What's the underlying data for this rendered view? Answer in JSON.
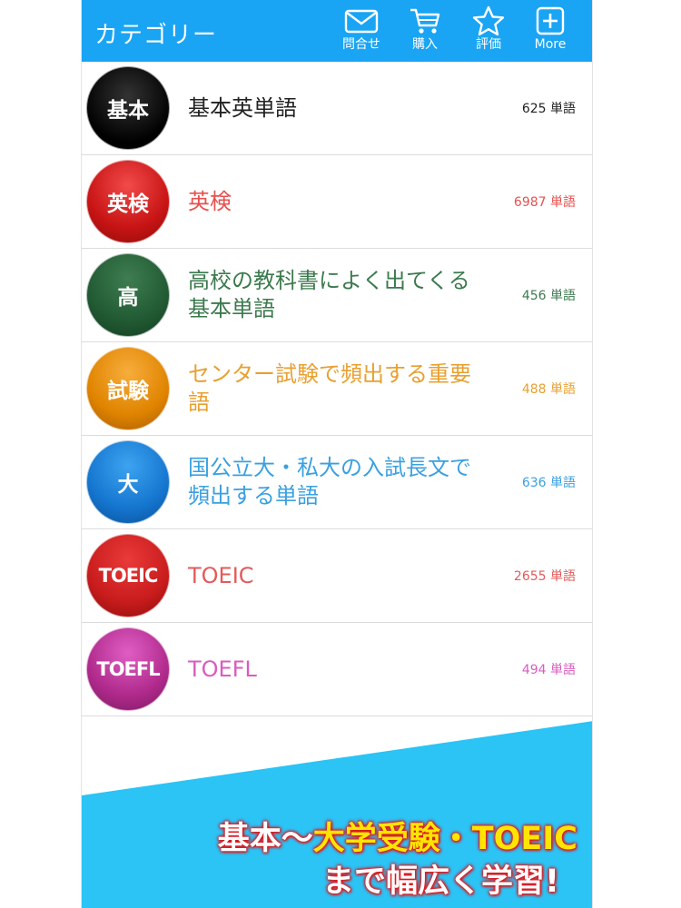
{
  "header": {
    "title": "カテゴリー",
    "buttons": [
      {
        "label": "問合せ",
        "icon": "mail-icon"
      },
      {
        "label": "購入",
        "icon": "cart-icon"
      },
      {
        "label": "評価",
        "icon": "star-icon"
      },
      {
        "label": "More",
        "icon": "plus-box-icon"
      }
    ],
    "color": "#1aa4f4"
  },
  "categories": [
    {
      "badge": "基本",
      "title": "基本英単語",
      "count": "625 単語",
      "color": "#222222",
      "badge_color": "#000000"
    },
    {
      "badge": "英検",
      "title": "英検",
      "count": "6987 単語",
      "color": "#e8504e",
      "badge_color": "#d11b1b"
    },
    {
      "badge": "高",
      "title": "高校の教科書によく出てくる基本単語",
      "count": "456 単語",
      "color": "#3c7a4e",
      "badge_color": "#215a33"
    },
    {
      "badge": "試験",
      "title": "センター試験で頻出する重要語",
      "count": "488 単語",
      "color": "#e8a030",
      "badge_color": "#e08400"
    },
    {
      "badge": "大",
      "title": "国公立大・私大の入試長文で頻出する単語",
      "count": "636 単語",
      "color": "#3aa0e0",
      "badge_color": "#1576cf"
    },
    {
      "badge": "TOEIC",
      "title": "TOEIC",
      "count": "2655 単語",
      "color": "#e45a5a",
      "badge_color": "#c91c1c"
    },
    {
      "badge": "TOEFL",
      "title": "TOEFL",
      "count": "494 単語",
      "color": "#d95cc0",
      "badge_color": "#b02a8c"
    }
  ],
  "promo": {
    "line1_a": "基本～",
    "line1_b": "大学受験・TOEIC",
    "line2": "まで幅広く学習!"
  },
  "banner_color": "#2cc3f5"
}
